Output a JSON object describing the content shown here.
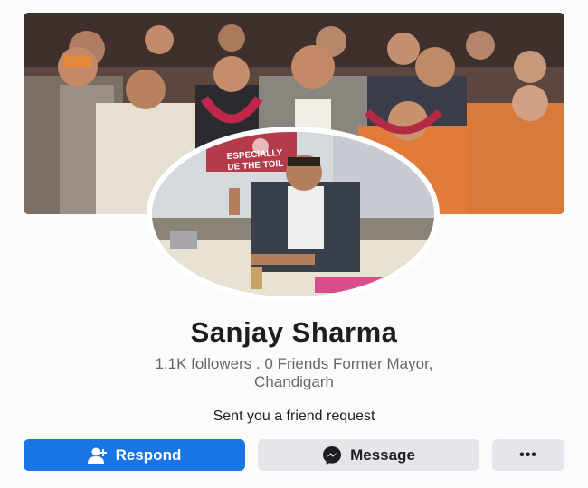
{
  "profile": {
    "name": "Sanjay Sharma",
    "subtitle_line1": "1.1K followers . 0 Friends Former Mayor,",
    "subtitle_line2": "Chandigarh",
    "request_text": "Sent you a friend request",
    "banner_line1": "ESPECIALLY",
    "banner_line2": "DE THE TOIL"
  },
  "actions": {
    "respond_label": "Respond",
    "respond_icon": "add-friend-icon",
    "message_label": "Message",
    "message_icon": "messenger-icon",
    "more_label": "•••"
  },
  "colors": {
    "primary": "#1b74e4",
    "secondary_button": "#e4e6eb",
    "text": "#1c1e21",
    "muted_text": "#65676b"
  }
}
